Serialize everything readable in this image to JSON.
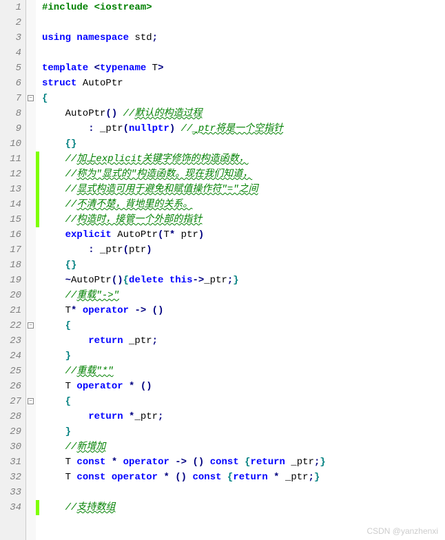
{
  "watermark": "CSDN @yanzhenxi",
  "lines": [
    {
      "n": 1,
      "fold": null,
      "changed": false,
      "tokens": [
        [
          "pp",
          "#include "
        ],
        [
          "ppinc",
          "<iostream>"
        ]
      ]
    },
    {
      "n": 2,
      "fold": null,
      "changed": false,
      "tokens": []
    },
    {
      "n": 3,
      "fold": null,
      "changed": false,
      "tokens": [
        [
          "kw",
          "using "
        ],
        [
          "kw",
          "namespace "
        ],
        [
          "std",
          "std"
        ],
        [
          "op",
          ";"
        ]
      ]
    },
    {
      "n": 4,
      "fold": null,
      "changed": false,
      "tokens": []
    },
    {
      "n": 5,
      "fold": null,
      "changed": false,
      "tokens": [
        [
          "kw",
          "template "
        ],
        [
          "op",
          "<"
        ],
        [
          "kw",
          "typename "
        ],
        [
          "ident",
          "T"
        ],
        [
          "op",
          ">"
        ]
      ]
    },
    {
      "n": 6,
      "fold": null,
      "changed": false,
      "tokens": [
        [
          "kw",
          "struct "
        ],
        [
          "ident",
          "AutoPtr"
        ]
      ]
    },
    {
      "n": 7,
      "fold": "minus",
      "changed": false,
      "tokens": [
        [
          "brace",
          "{"
        ]
      ]
    },
    {
      "n": 8,
      "fold": null,
      "changed": false,
      "tokens": [
        [
          "ident",
          "    AutoPtr"
        ],
        [
          "paren",
          "() "
        ],
        [
          "comment",
          "//"
        ],
        [
          "comment wavy",
          "默认的构造过程"
        ]
      ]
    },
    {
      "n": 9,
      "fold": null,
      "changed": false,
      "tokens": [
        [
          "ident",
          "        "
        ],
        [
          "op",
          ": "
        ],
        [
          "ident",
          "_ptr"
        ],
        [
          "paren",
          "("
        ],
        [
          "kw",
          "nullptr"
        ],
        [
          "paren",
          ") "
        ],
        [
          "comment",
          "//"
        ],
        [
          "comment wavy",
          "_ptr将是一个空指针"
        ]
      ]
    },
    {
      "n": 10,
      "fold": null,
      "changed": false,
      "tokens": [
        [
          "ident",
          "    "
        ],
        [
          "brace",
          "{}"
        ]
      ]
    },
    {
      "n": 11,
      "fold": null,
      "changed": true,
      "tokens": [
        [
          "ident",
          "    "
        ],
        [
          "comment",
          "//"
        ],
        [
          "comment wavy",
          "加上explicit关键字修饰的构造函数，"
        ]
      ]
    },
    {
      "n": 12,
      "fold": null,
      "changed": true,
      "tokens": [
        [
          "ident",
          "    "
        ],
        [
          "comment",
          "//"
        ],
        [
          "comment wavy",
          "称为\"显式的\"构造函数。现在我们知道，"
        ]
      ]
    },
    {
      "n": 13,
      "fold": null,
      "changed": true,
      "tokens": [
        [
          "ident",
          "    "
        ],
        [
          "comment",
          "//"
        ],
        [
          "comment wavy",
          "显式构造可用于避免和赋值操作符\"=\"之间"
        ]
      ]
    },
    {
      "n": 14,
      "fold": null,
      "changed": true,
      "tokens": [
        [
          "ident",
          "    "
        ],
        [
          "comment",
          "//"
        ],
        [
          "comment wavy",
          "不清不楚，背地里的关系。"
        ]
      ]
    },
    {
      "n": 15,
      "fold": null,
      "changed": true,
      "tokens": [
        [
          "ident",
          "    "
        ],
        [
          "comment",
          "//"
        ],
        [
          "comment wavy",
          "构造时，接管一个外部的指针"
        ]
      ]
    },
    {
      "n": 16,
      "fold": null,
      "changed": false,
      "tokens": [
        [
          "ident",
          "    "
        ],
        [
          "kw",
          "explicit "
        ],
        [
          "ident",
          "AutoPtr"
        ],
        [
          "paren",
          "("
        ],
        [
          "ident",
          "T"
        ],
        [
          "op",
          "* "
        ],
        [
          "ident",
          "ptr"
        ],
        [
          "paren",
          ")"
        ]
      ]
    },
    {
      "n": 17,
      "fold": null,
      "changed": false,
      "tokens": [
        [
          "ident",
          "        "
        ],
        [
          "op",
          ": "
        ],
        [
          "ident",
          "_ptr"
        ],
        [
          "paren",
          "("
        ],
        [
          "ident",
          "ptr"
        ],
        [
          "paren",
          ")"
        ]
      ]
    },
    {
      "n": 18,
      "fold": null,
      "changed": false,
      "tokens": [
        [
          "ident",
          "    "
        ],
        [
          "brace",
          "{}"
        ]
      ]
    },
    {
      "n": 19,
      "fold": null,
      "changed": false,
      "tokens": [
        [
          "ident",
          "    "
        ],
        [
          "op",
          "~"
        ],
        [
          "ident",
          "AutoPtr"
        ],
        [
          "paren",
          "()"
        ],
        [
          "brace",
          "{"
        ],
        [
          "kw",
          "delete "
        ],
        [
          "kw",
          "this"
        ],
        [
          "op",
          "->"
        ],
        [
          "ident",
          "_ptr"
        ],
        [
          "op",
          ";"
        ],
        [
          "brace",
          "}"
        ]
      ]
    },
    {
      "n": 20,
      "fold": null,
      "changed": false,
      "tokens": [
        [
          "ident",
          "    "
        ],
        [
          "comment",
          "//"
        ],
        [
          "comment wavy",
          "重载\"->\""
        ]
      ]
    },
    {
      "n": 21,
      "fold": null,
      "changed": false,
      "tokens": [
        [
          "ident",
          "    T"
        ],
        [
          "op",
          "* "
        ],
        [
          "kw",
          "operator "
        ],
        [
          "op",
          "-> "
        ],
        [
          "paren",
          "()"
        ]
      ]
    },
    {
      "n": 22,
      "fold": "minus",
      "changed": false,
      "tokens": [
        [
          "ident",
          "    "
        ],
        [
          "brace",
          "{"
        ]
      ]
    },
    {
      "n": 23,
      "fold": null,
      "changed": false,
      "tokens": [
        [
          "ident",
          "        "
        ],
        [
          "kw",
          "return "
        ],
        [
          "ident",
          "_ptr"
        ],
        [
          "op",
          ";"
        ]
      ]
    },
    {
      "n": 24,
      "fold": null,
      "changed": false,
      "tokens": [
        [
          "ident",
          "    "
        ],
        [
          "brace",
          "}"
        ]
      ]
    },
    {
      "n": 25,
      "fold": null,
      "changed": false,
      "tokens": [
        [
          "ident",
          "    "
        ],
        [
          "comment",
          "//"
        ],
        [
          "comment wavy",
          "重载\"*\""
        ]
      ]
    },
    {
      "n": 26,
      "fold": null,
      "changed": false,
      "tokens": [
        [
          "ident",
          "    T "
        ],
        [
          "kw",
          "operator "
        ],
        [
          "op",
          "* "
        ],
        [
          "paren",
          "()"
        ]
      ]
    },
    {
      "n": 27,
      "fold": "minus",
      "changed": false,
      "tokens": [
        [
          "ident",
          "    "
        ],
        [
          "brace",
          "{"
        ]
      ]
    },
    {
      "n": 28,
      "fold": null,
      "changed": false,
      "tokens": [
        [
          "ident",
          "        "
        ],
        [
          "kw",
          "return "
        ],
        [
          "op",
          "*"
        ],
        [
          "ident",
          "_ptr"
        ],
        [
          "op",
          ";"
        ]
      ]
    },
    {
      "n": 29,
      "fold": null,
      "changed": false,
      "tokens": [
        [
          "ident",
          "    "
        ],
        [
          "brace",
          "}"
        ]
      ]
    },
    {
      "n": 30,
      "fold": null,
      "changed": false,
      "tokens": [
        [
          "ident",
          "    "
        ],
        [
          "comment",
          "//"
        ],
        [
          "comment wavy",
          "新增加"
        ]
      ]
    },
    {
      "n": 31,
      "fold": null,
      "changed": false,
      "tokens": [
        [
          "ident",
          "    T "
        ],
        [
          "kw",
          "const "
        ],
        [
          "op",
          "* "
        ],
        [
          "kw",
          "operator "
        ],
        [
          "op",
          "-> "
        ],
        [
          "paren",
          "() "
        ],
        [
          "kw",
          "const "
        ],
        [
          "brace",
          "{"
        ],
        [
          "kw",
          "return "
        ],
        [
          "ident",
          "_ptr"
        ],
        [
          "op",
          ";"
        ],
        [
          "brace",
          "}"
        ]
      ]
    },
    {
      "n": 32,
      "fold": null,
      "changed": false,
      "tokens": [
        [
          "ident",
          "    T "
        ],
        [
          "kw",
          "const "
        ],
        [
          "kw",
          "operator "
        ],
        [
          "op",
          "* "
        ],
        [
          "paren",
          "() "
        ],
        [
          "kw",
          "const "
        ],
        [
          "brace",
          "{"
        ],
        [
          "kw",
          "return "
        ],
        [
          "op",
          "* "
        ],
        [
          "ident",
          "_ptr"
        ],
        [
          "op",
          ";"
        ],
        [
          "brace",
          "}"
        ]
      ]
    },
    {
      "n": 33,
      "fold": null,
      "changed": false,
      "tokens": []
    },
    {
      "n": 34,
      "fold": null,
      "changed": true,
      "tokens": [
        [
          "ident",
          "    "
        ],
        [
          "comment",
          "//"
        ],
        [
          "comment wavy",
          "支持数组"
        ]
      ]
    }
  ]
}
